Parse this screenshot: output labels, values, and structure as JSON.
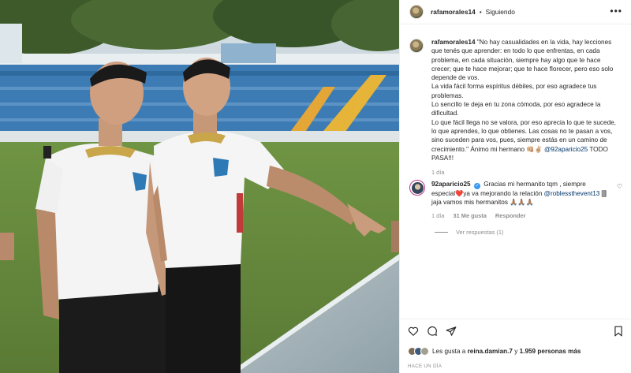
{
  "post": {
    "username": "rafamorales14",
    "separator": "•",
    "follow_status": "Siguiendo",
    "more_label": "•••"
  },
  "caption": {
    "username": "rafamorales14",
    "lines": [
      "\"No hay casualidades en la vida, hay lecciones",
      "que tenés que aprender: en todo lo que enfrentas, en cada",
      "problema, en cada situación, siempre hay algo que te hace",
      "crecer; que te hace mejorar; que te hace florecer, pero eso solo",
      "depende de vos.",
      "La vida fácil forma espíritus débiles, por eso agradece tus",
      "problemas.",
      "Lo sencillo te deja en tu zona cómoda, por eso agradece la",
      "dificultad.",
      "Lo que fácil llega no se valora, por eso aprecia lo que te sucede,",
      "lo que aprendes, lo que obtienes. Las cosas no te pasan a vos,",
      "sino suceden para vos, pues, siempre estás en un camino de",
      "crecimiento.\" Ánimo mi hermano 👊🏼✌🏼"
    ],
    "mention": "@92aparicio25",
    "tail": "TODO",
    "last_line": "PASA!!!",
    "time": "1 día"
  },
  "comment": {
    "username": "92aparicio25",
    "verified_mark": "✓",
    "text_1": "Gracias mi hermanito tqm , siempre",
    "text_2a": "especial",
    "heart": "❤️",
    "text_2b": "ya va mejorando la relación",
    "mention": "@roblessthevent13",
    "text_2c": "🀫",
    "text_3": "jaja vamos mis hermanitos 🙏🏽🙏🏽🙏🏽",
    "time": "1 día",
    "likes": "31 Me gusta",
    "reply": "Responder",
    "like_icon": "♡",
    "view_replies": "Ver respuestas (1)"
  },
  "footer": {
    "likes_prefix": "Les gusta a",
    "liker": "reina.damian.7",
    "likes_mid": "y",
    "likes_count": "1.959 personas más",
    "posted_ago": "HACE UN DÍA"
  },
  "colors": {
    "link": "#00376b",
    "muted": "#8e8e8e",
    "verified": "#3897f0"
  },
  "icons": [
    "more-options-icon",
    "heart-icon",
    "comment-icon",
    "share-icon",
    "bookmark-icon"
  ]
}
